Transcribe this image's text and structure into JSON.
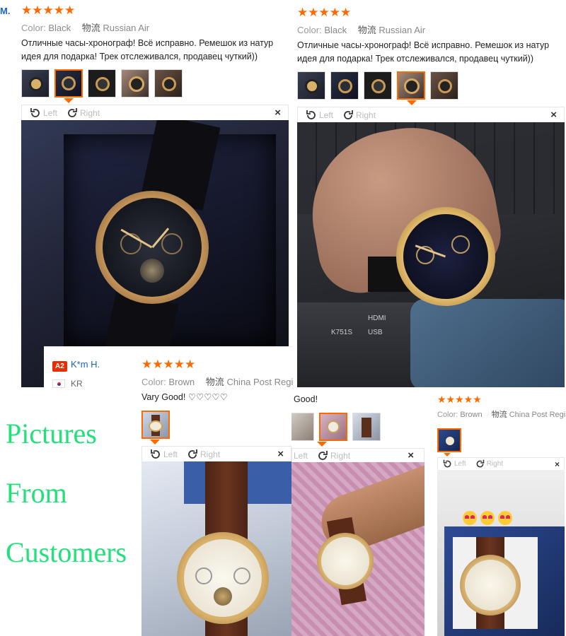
{
  "reviews": [
    {
      "reviewer_fragment": "M.",
      "stars": "★★★★★",
      "color_label": "Color:",
      "color_value": "Black",
      "shipping_label": "物流",
      "shipping_value": "Russian Air",
      "text_line1": "Отличные часы-хронограф! Всё исправно. Ремешок из натур",
      "text_line2": "идея для подарка! Трек отслеживался, продавец чуткий))",
      "rotate_left": "Left",
      "rotate_right": "Right",
      "close": "×"
    },
    {
      "stars": "★★★★★",
      "color_label": "Color:",
      "color_value": "Black",
      "shipping_label": "物流",
      "shipping_value": "Russian Air",
      "text_line1": "Отличные часы-хронограф! Всё исправно. Ремешок из натур",
      "text_line2": "идея для подарка! Трек отслеживался, продавец чуткий))",
      "rotate_left": "Left",
      "rotate_right": "Right",
      "close": "×"
    },
    {
      "badge": "A2",
      "reviewer": "K*m H.",
      "country": "KR",
      "stars": "★★★★★",
      "color_label": "Color:",
      "color_value": "Brown",
      "shipping_label": "物流",
      "shipping_value": "China Post Regi",
      "text_line1": "Vary Good! ♡♡♡♡♡",
      "rotate_left": "Left",
      "rotate_right": "Right",
      "close": "×"
    },
    {
      "text_line1": "Good!",
      "rotate_left": "Left",
      "rotate_right": "Right",
      "close": "×"
    },
    {
      "stars": "★★★★★",
      "color_label": "Color:",
      "color_value": "Brown",
      "shipping_label": "物流",
      "shipping_value": "China Post Regis",
      "rotate_left": "Left",
      "rotate_right": "Right",
      "close": "×"
    }
  ],
  "overlay_caption": {
    "line1": "Pictures",
    "line2": "From",
    "line3": "Customers"
  },
  "photo2_keyboard": {
    "model": "K751S",
    "brand": "HDMI",
    "keys": "USB"
  },
  "colors": {
    "accent": "#ff6a00",
    "caption_green": "#22e07a",
    "name_blue": "#1a66b8"
  }
}
